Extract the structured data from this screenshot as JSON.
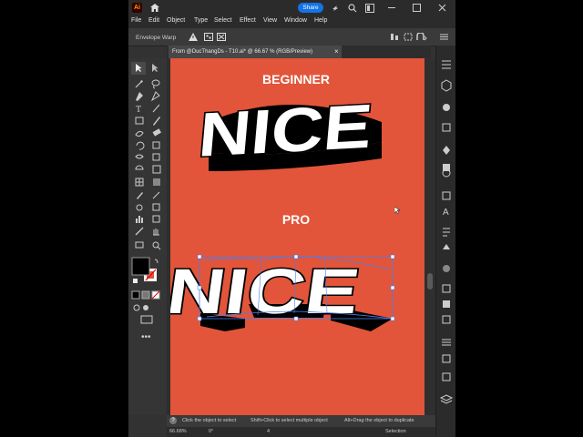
{
  "top": {
    "app_icon_label": "Ai",
    "share_label": "Share"
  },
  "menu": [
    "File",
    "Edit",
    "Object",
    "Type",
    "Select",
    "Effect",
    "View",
    "Window",
    "Help"
  ],
  "control": {
    "mode_label": "Envelope Warp"
  },
  "tab": {
    "title": "From @DucThangDs - T10.ai* @ 66.67 % (RGB/Preview)",
    "close": "×"
  },
  "artboard": {
    "beginner_label": "BEGINNER",
    "beginner_word": "NICE",
    "pro_label": "PRO",
    "pro_word": "NICE"
  },
  "status": {
    "help_icon": "?",
    "hint_part1": "Click the object to select",
    "hint_part2": "Shift+Click to select multiple object",
    "hint_part3": "Alt+Drag the object to duplicate",
    "zoom": "66.68%",
    "rotation": "0°",
    "artboard_num": "4",
    "tool_name": "Selection"
  },
  "colors": {
    "artboard": "#e2553a",
    "share": "#1473e6",
    "fill": "#000000"
  }
}
